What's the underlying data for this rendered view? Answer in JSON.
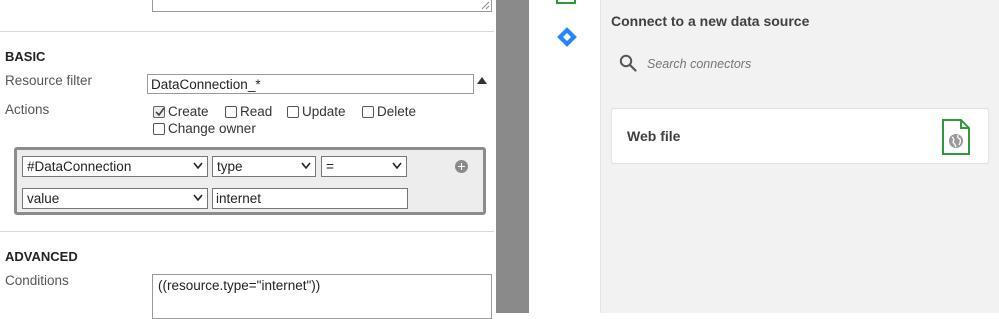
{
  "basic": {
    "section_title": "BASIC",
    "resource_filter_label": "Resource filter",
    "resource_filter_value": "DataConnection_*",
    "actions_label": "Actions",
    "actions": {
      "create": "Create",
      "read": "Read",
      "update": "Update",
      "delete": "Delete",
      "change_owner": "Change owner"
    }
  },
  "rule": {
    "resource_select": "#DataConnection",
    "property_select": "type",
    "operator_select": "=",
    "value_select": "value",
    "value_input": "internet"
  },
  "advanced": {
    "section_title": "ADVANCED",
    "conditions_label": "Conditions",
    "conditions_value": "((resource.type=\"internet\"))"
  },
  "connect": {
    "title": "Connect to a new data source",
    "search_placeholder": "Search connectors",
    "card_label": "Web file"
  },
  "colors": {
    "jira_blue": "#2684ff",
    "green": "#2e9a3c",
    "rule_border": "#8c8c8c",
    "gutter": "#8a8a8a"
  },
  "icons": {
    "sort": "sort-up-icon",
    "add": "plus-circle-icon",
    "search": "search-icon",
    "jira": "jira-icon",
    "webfile": "web-file-icon"
  }
}
